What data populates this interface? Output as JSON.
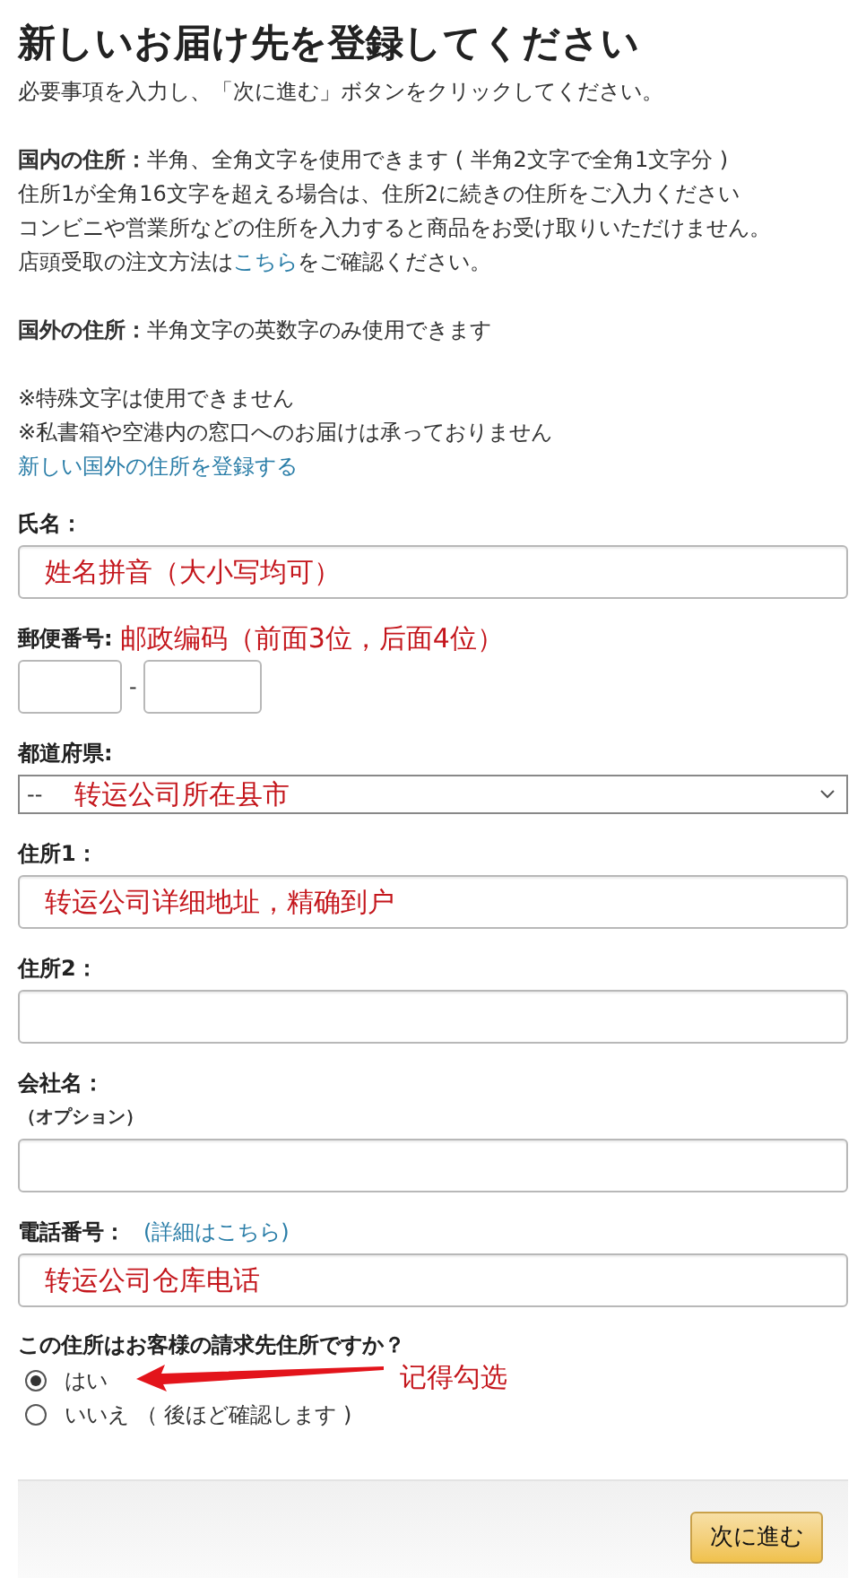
{
  "heading": "新しいお届け先を登録してください",
  "intro": "必要事項を入力し、「次に進む」ボタンをクリックしてください。",
  "domestic_lines": [
    "**国内の住所：**半角、全角文字を使用できます ( 半角2文字で全角1文字分 )",
    "住所1が全角16文字を超える場合は、住所2に続きの住所をご入力ください",
    "コンビニや営業所などの住所を入力すると商品をお受け取りいただけません。"
  ],
  "pickup_line": {
    "before": "店頭受取の注文方法は",
    "link": "こちら",
    "after": "をご確認ください。"
  },
  "foreign_line": "**国外の住所：**半角文字の英数字のみ使用できます",
  "warnings": [
    "※特殊文字は使用できません",
    "※私書箱や空港内の窓口へのお届けは承っておりません"
  ],
  "foreign_link": "新しい国外の住所を登録する",
  "fields": [
    {
      "kind": "text",
      "label": "氏名：",
      "annotation": "姓名拼音（大小写均可）"
    },
    {
      "kind": "postal",
      "label": "郵便番号:",
      "annotation": "邮政编码（前面3位，后面4位）",
      "separator": "-"
    },
    {
      "kind": "select",
      "label": "都道府県:",
      "value": "--",
      "annotation": "转运公司所在县市"
    },
    {
      "kind": "text",
      "label": "住所1：",
      "annotation": "转运公司详细地址，精确到户"
    },
    {
      "kind": "text",
      "label": "住所2："
    },
    {
      "kind": "text",
      "label": "会社名：",
      "note": "（オプション）"
    },
    {
      "kind": "text",
      "label": "電話番号：",
      "help_link": "(詳細はこちら)",
      "annotation": "转运公司仓库电话"
    }
  ],
  "question": "この住所はお客様の請求先住所ですか？",
  "options": [
    {
      "label": "はい",
      "selected": true,
      "annotation": "记得勾选"
    },
    {
      "label": "いいえ （ 後ほど確認します )",
      "selected": false
    }
  ],
  "submit": "次に進む"
}
